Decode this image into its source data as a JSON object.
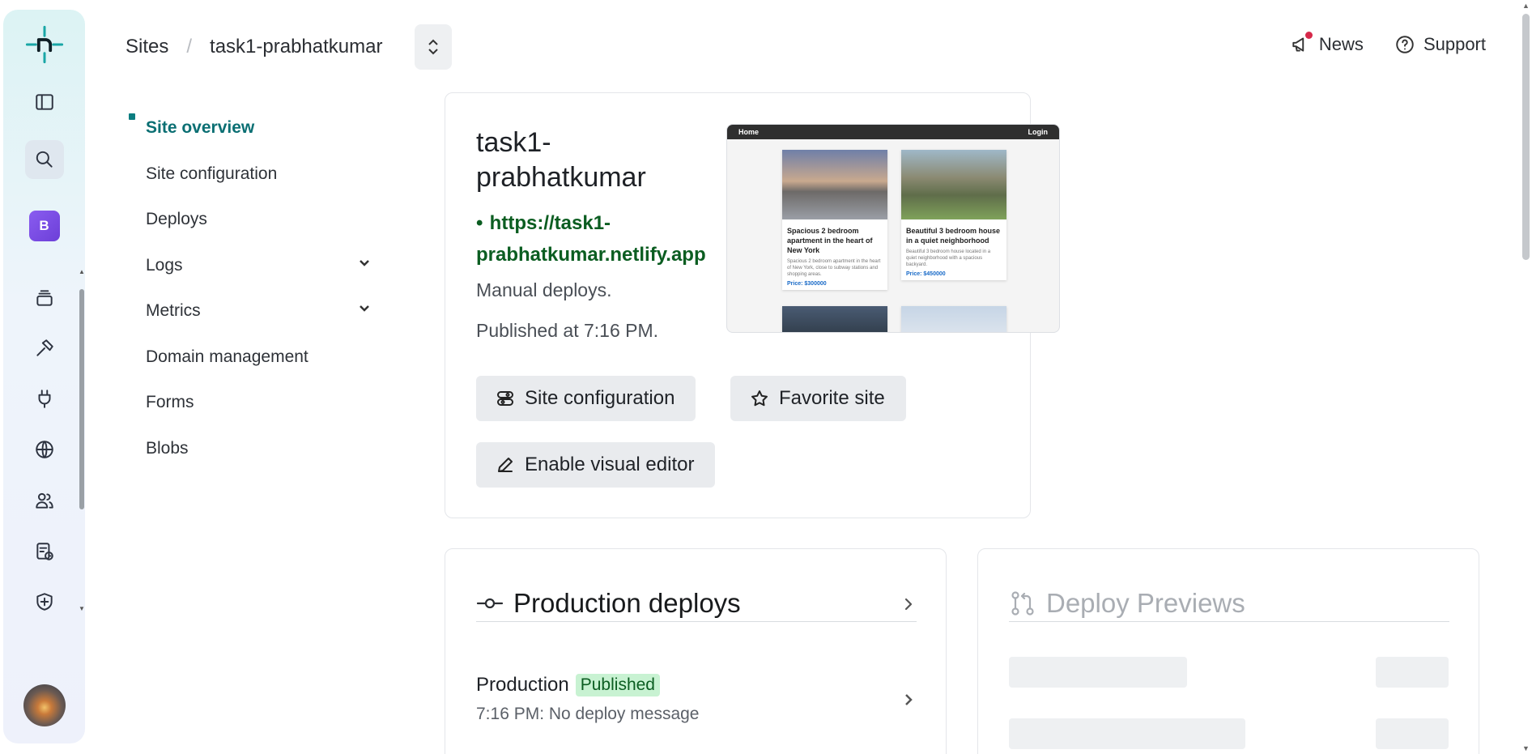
{
  "breadcrumb": {
    "root": "Sites",
    "separator": "/",
    "current": "task1-prabhatkumar"
  },
  "header": {
    "news_label": "News",
    "support_label": "Support"
  },
  "rail": {
    "team_initial": "B"
  },
  "sidenav": {
    "items": [
      {
        "label": "Site overview"
      },
      {
        "label": "Site configuration"
      },
      {
        "label": "Deploys"
      },
      {
        "label": "Logs"
      },
      {
        "label": "Metrics"
      },
      {
        "label": "Domain management"
      },
      {
        "label": "Forms"
      },
      {
        "label": "Blobs"
      }
    ]
  },
  "site": {
    "title_line1": "task1-",
    "title_line2": "prabhatkumar",
    "url_line1": "https://task1-",
    "url_line2": "prabhatkumar.netlify.app",
    "deploy_mode": "Manual deploys.",
    "published": "Published at 7:16 PM.",
    "buttons": {
      "configuration": "Site configuration",
      "favorite": "Favorite site",
      "visual_editor": "Enable visual editor"
    }
  },
  "preview": {
    "nav_home": "Home",
    "nav_login": "Login",
    "cards": [
      {
        "title": "Spacious 2 bedroom apartment in the heart of New York",
        "desc": "Spacious 2 bedroom apartment in the heart of New York, close to subway stations and shopping areas.",
        "price": "Price: $300000"
      },
      {
        "title": "Beautiful 3 bedroom house in a quiet neighborhood",
        "desc": "Beautiful 3 bedroom house located in a quiet neighborhood with a spacious backyard.",
        "price": "Price: $450000"
      }
    ]
  },
  "production": {
    "heading": "Production deploys",
    "context": "Production",
    "status": "Published",
    "message": "7:16 PM: No deploy message"
  },
  "previews": {
    "heading": "Deploy Previews"
  }
}
